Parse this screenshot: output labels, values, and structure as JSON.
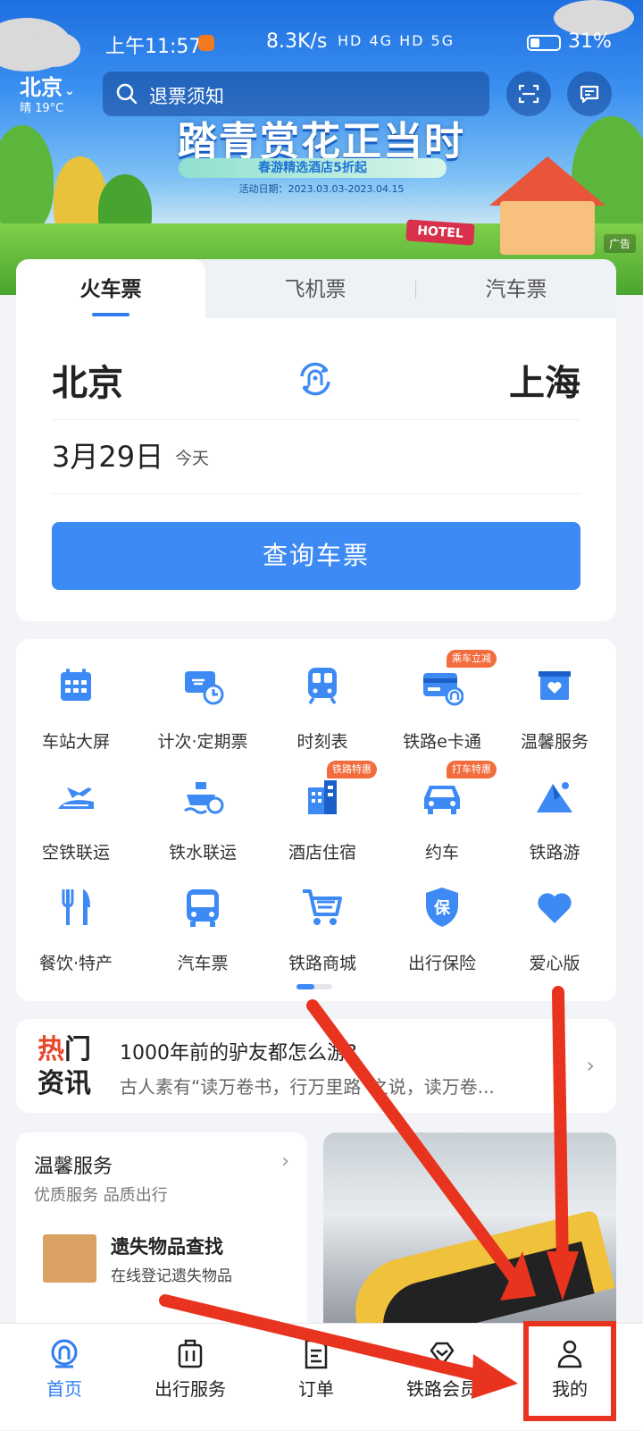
{
  "status_bar": {
    "time": "上午11:57",
    "net_speed": "8.3K/s",
    "signal_text": "HD 4G  HD 5G",
    "battery": "31%"
  },
  "header": {
    "city": "北京",
    "weather": "晴 19°C",
    "search_placeholder": "退票须知"
  },
  "banner": {
    "title": "踏青赏花正当时",
    "subtitle": "春游精选酒店5折起",
    "date": "活动日期：2023.03.03-2023.04.15",
    "sign": "HOTEL",
    "ad_label": "广告"
  },
  "ticket": {
    "tabs": [
      {
        "label": "火车票"
      },
      {
        "label": "飞机票"
      },
      {
        "label": "汽车票"
      }
    ],
    "from": "北京",
    "to": "上海",
    "date": "3月29日",
    "date_note": "今天",
    "query_button": "查询车票"
  },
  "services": [
    {
      "label": "车站大屏",
      "icon": "station-screen-icon"
    },
    {
      "label": "计次·定期票",
      "icon": "ticket-pass-icon"
    },
    {
      "label": "时刻表",
      "icon": "train-timetable-icon"
    },
    {
      "label": "铁路e卡通",
      "icon": "rail-card-icon",
      "badge": "乘车立减"
    },
    {
      "label": "温馨服务",
      "icon": "care-service-icon"
    },
    {
      "label": "空铁联运",
      "icon": "air-rail-icon"
    },
    {
      "label": "铁水联运",
      "icon": "rail-ship-icon"
    },
    {
      "label": "酒店住宿",
      "icon": "hotel-icon",
      "badge": "铁路特惠"
    },
    {
      "label": "约车",
      "icon": "car-icon",
      "badge": "打车特惠"
    },
    {
      "label": "铁路游",
      "icon": "mountain-tour-icon"
    },
    {
      "label": "餐饮·特产",
      "icon": "dining-icon"
    },
    {
      "label": "汽车票",
      "icon": "bus-icon"
    },
    {
      "label": "铁路商城",
      "icon": "shopping-cart-icon"
    },
    {
      "label": "出行保险",
      "icon": "insurance-shield-icon"
    },
    {
      "label": "爱心版",
      "icon": "heart-icon"
    }
  ],
  "news": {
    "tag_line1_hl": "热",
    "tag_line1": "门",
    "tag_line2": "资讯",
    "title": "1000年前的驴友都怎么游?",
    "desc": "古人素有“读万卷书，行万里路”之说，读万卷..."
  },
  "care_card": {
    "title": "温馨服务",
    "subtitle": "优质服务 品质出行",
    "item_title": "遗失物品查找",
    "item_desc": "在线登记遗失物品"
  },
  "tabbar": [
    {
      "label": "首页",
      "icon": "home-icon"
    },
    {
      "label": "出行服务",
      "icon": "luggage-icon"
    },
    {
      "label": "订单",
      "icon": "order-icon"
    },
    {
      "label": "铁路会员",
      "icon": "member-icon"
    },
    {
      "label": "我的",
      "icon": "profile-icon"
    }
  ],
  "colors": {
    "accent": "#2f7df2",
    "button": "#3d8af4",
    "badge": "#f26d3d",
    "annotation": "#e8331f"
  }
}
